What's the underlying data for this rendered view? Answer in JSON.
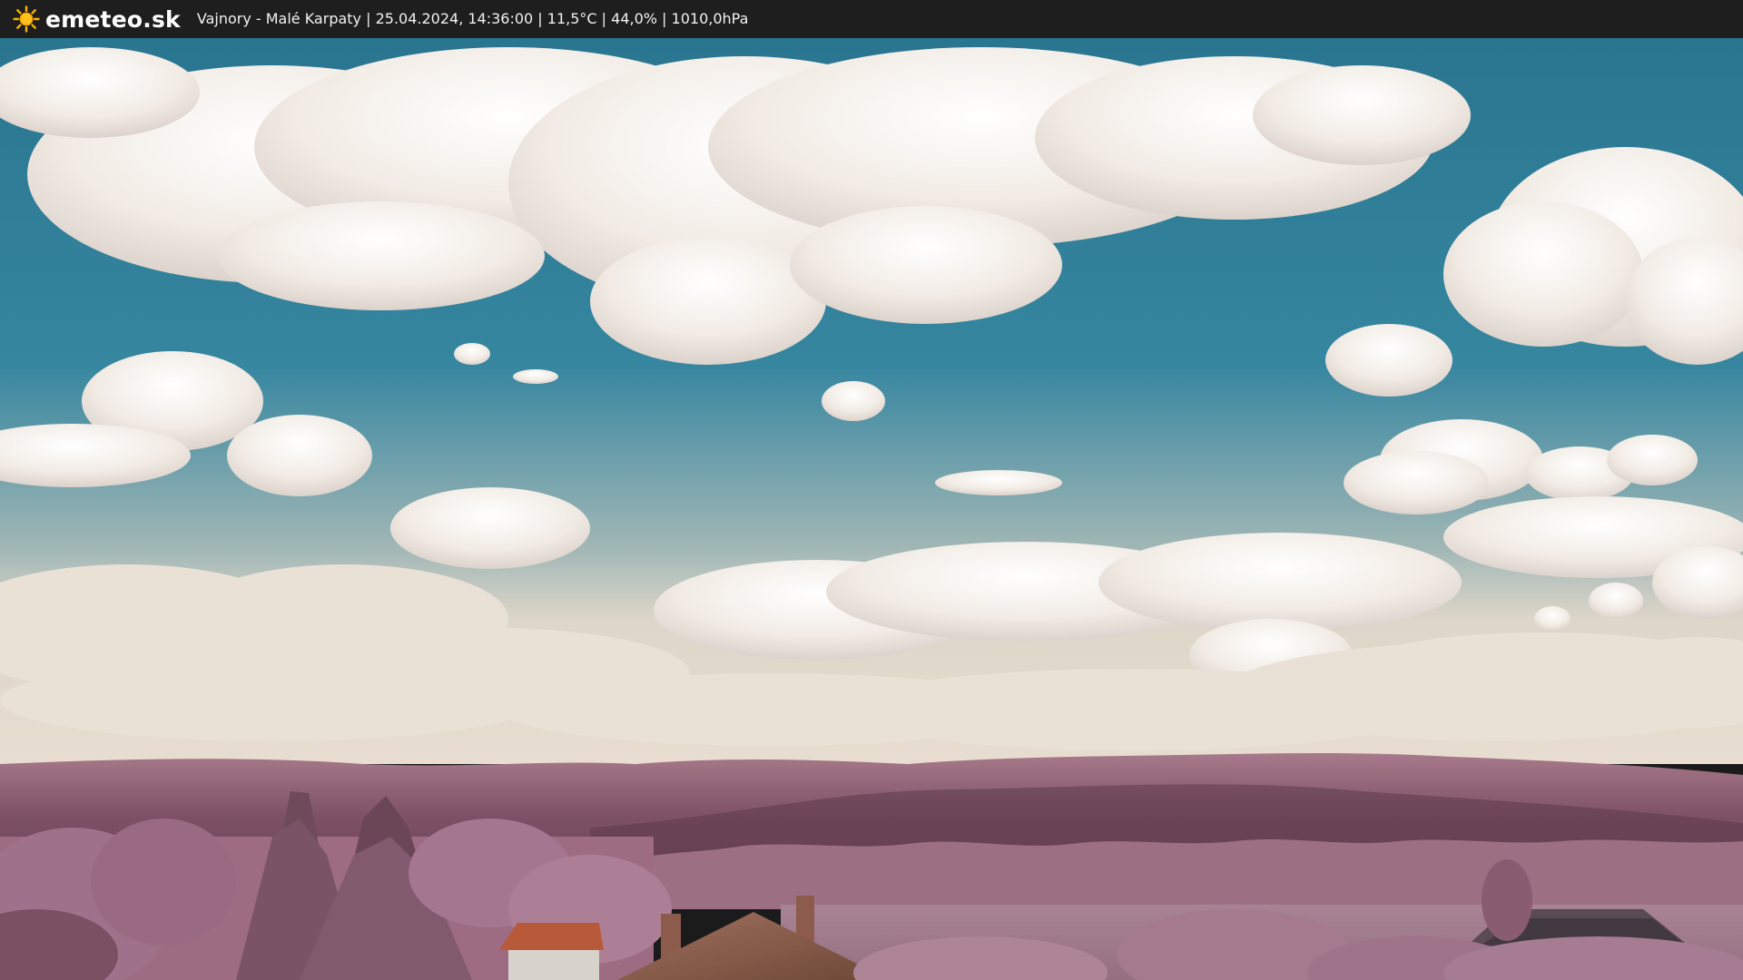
{
  "header": {
    "logo_text": "emeteo.sk",
    "caption": "Vajnory - Malé Karpaty | 25.04.2024, 14:36:00 | 11,5°C | 44,0% | 1010,0hPa"
  },
  "icons": {
    "logo": "sun-icon"
  },
  "colors": {
    "sky": "#2f7f95",
    "cloud": "#f3ede6",
    "hills": "#8a5e72",
    "trees": "#b07a90",
    "roof": "#b85a3a"
  }
}
